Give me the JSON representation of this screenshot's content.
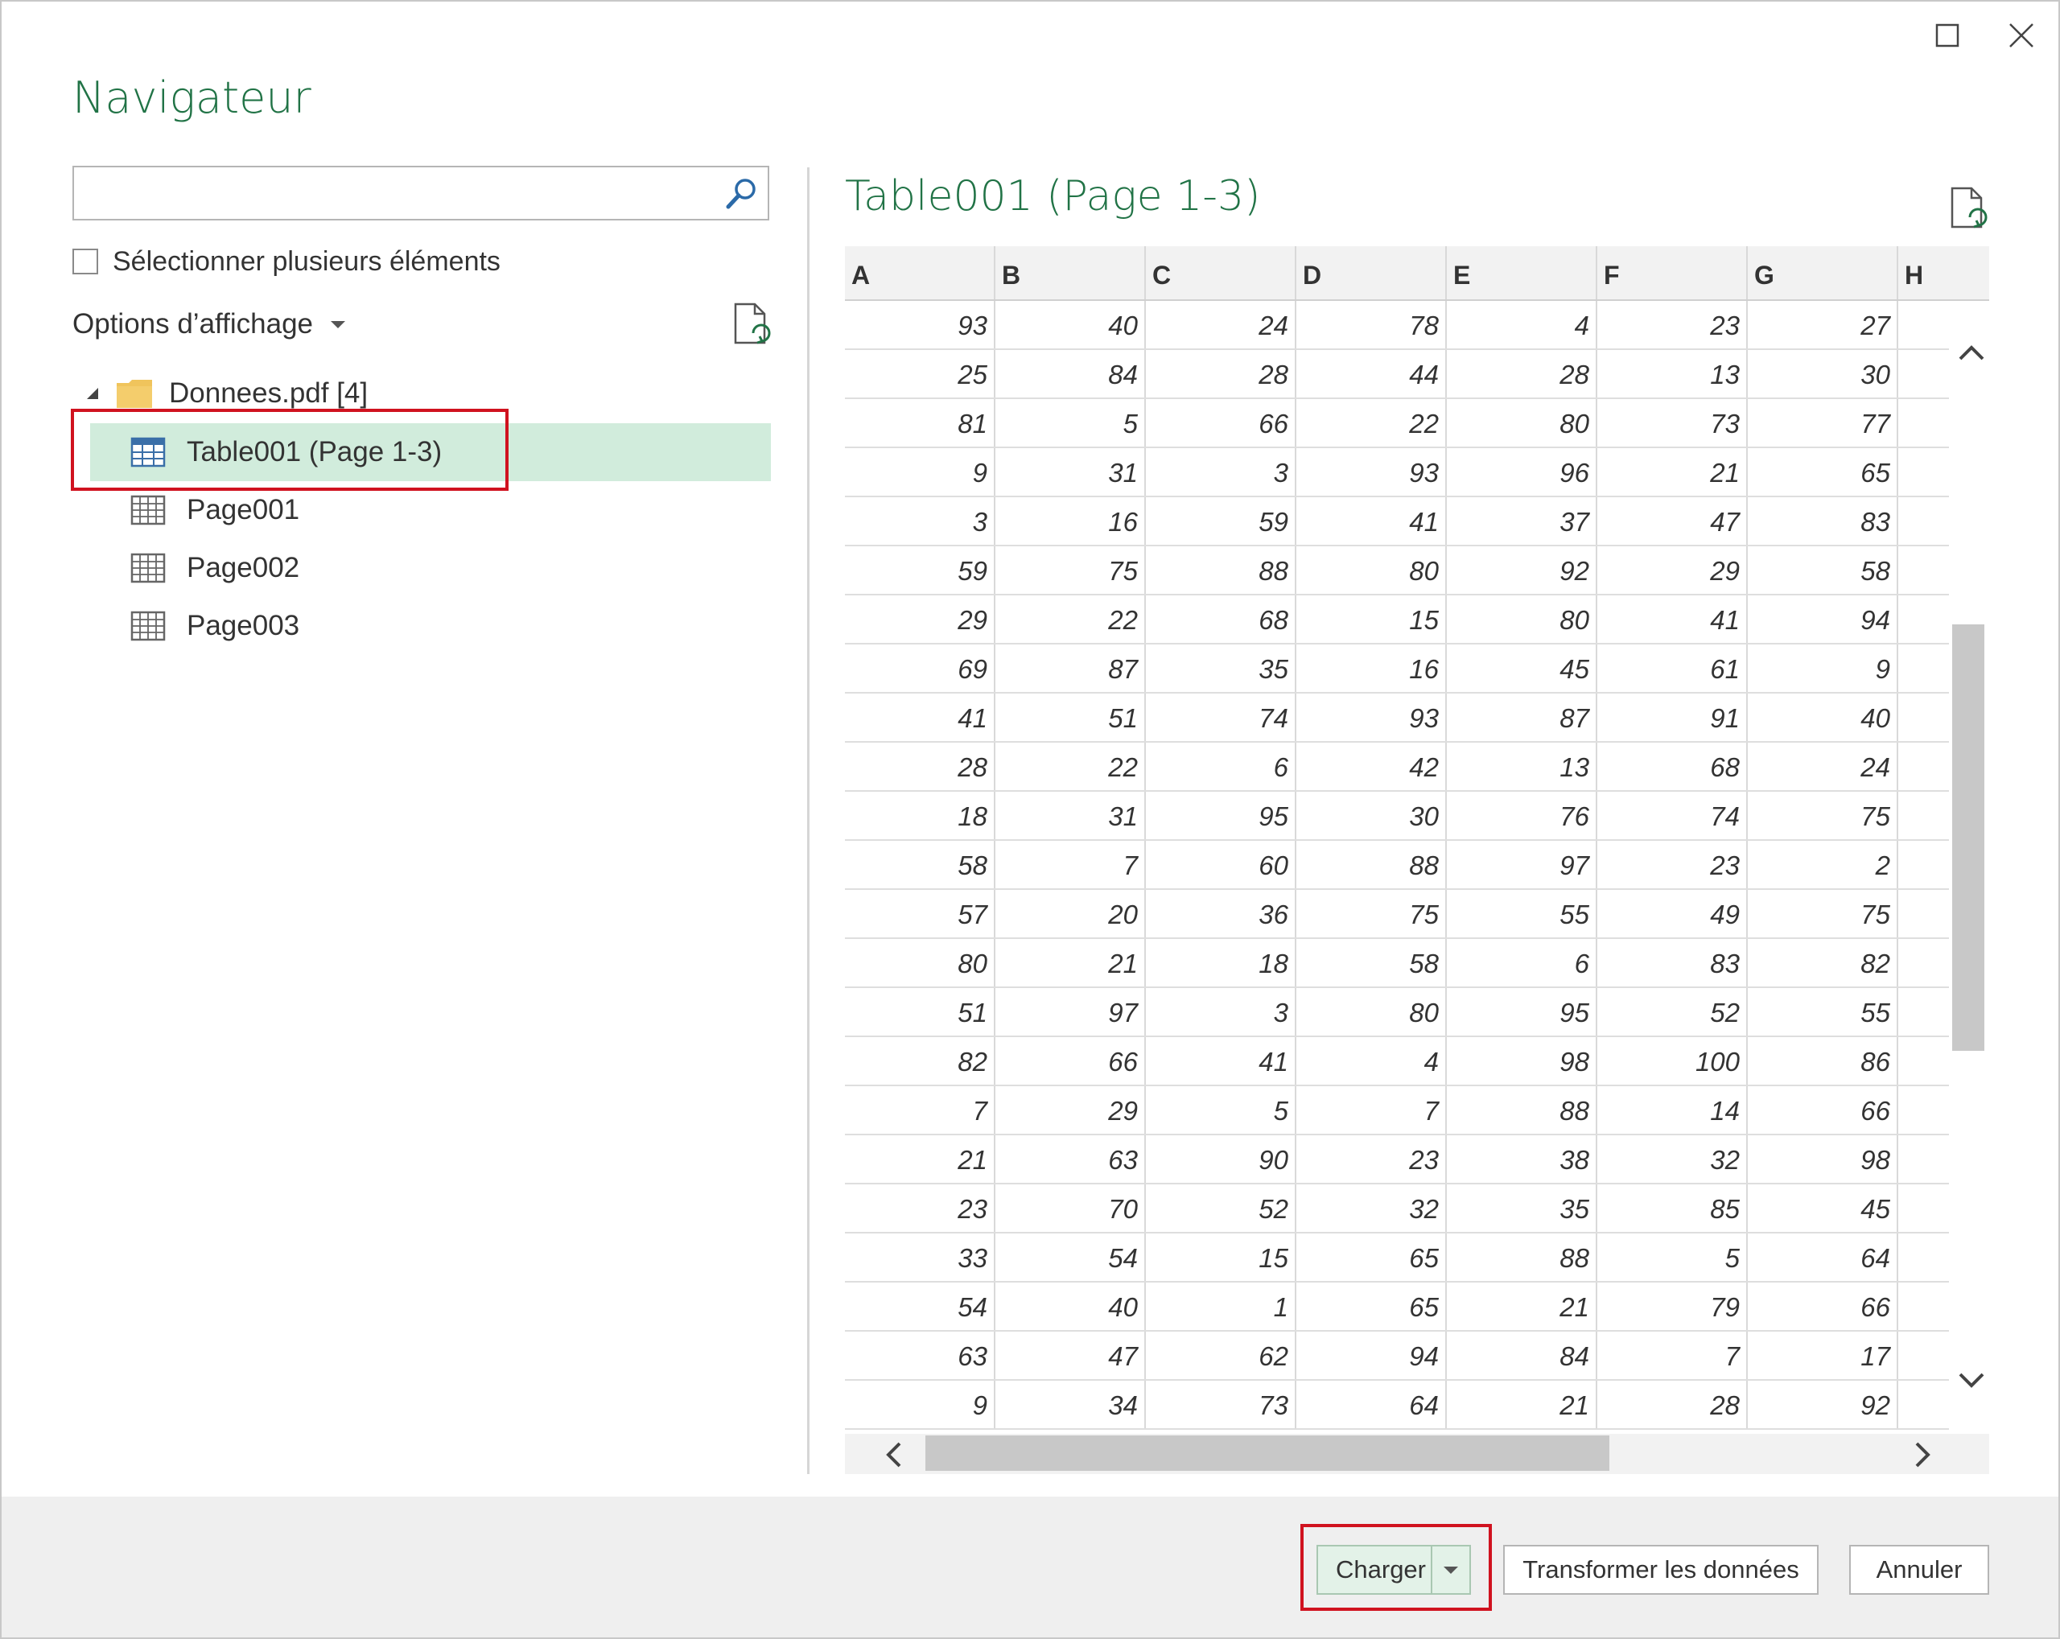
{
  "window": {
    "title": "Navigateur",
    "maximize_icon": "maximize-icon",
    "close_icon": "close-icon"
  },
  "left_pane": {
    "search": {
      "value": "",
      "placeholder": "",
      "icon": "search-icon"
    },
    "select_multiple_label": "Sélectionner plusieurs éléments",
    "display_options_label": "Options d’affichage",
    "refresh_icon": "refresh-document-icon",
    "tree": {
      "root_label": "Donnees.pdf [4]",
      "items": [
        {
          "label": "Table001 (Page 1-3)",
          "icon": "table-icon",
          "selected": true
        },
        {
          "label": "Page001",
          "icon": "page-grid-icon",
          "selected": false
        },
        {
          "label": "Page002",
          "icon": "page-grid-icon",
          "selected": false
        },
        {
          "label": "Page003",
          "icon": "page-grid-icon",
          "selected": false
        }
      ]
    }
  },
  "preview": {
    "title": "Table001 (Page 1-3)",
    "columns": [
      "A",
      "B",
      "C",
      "D",
      "E",
      "F",
      "G",
      "H"
    ],
    "rows": [
      [
        "93",
        "40",
        "24",
        "78",
        "4",
        "23",
        "27"
      ],
      [
        "25",
        "84",
        "28",
        "44",
        "28",
        "13",
        "30"
      ],
      [
        "81",
        "5",
        "66",
        "22",
        "80",
        "73",
        "77"
      ],
      [
        "9",
        "31",
        "3",
        "93",
        "96",
        "21",
        "65"
      ],
      [
        "3",
        "16",
        "59",
        "41",
        "37",
        "47",
        "83"
      ],
      [
        "59",
        "75",
        "88",
        "80",
        "92",
        "29",
        "58"
      ],
      [
        "29",
        "22",
        "68",
        "15",
        "80",
        "41",
        "94"
      ],
      [
        "69",
        "87",
        "35",
        "16",
        "45",
        "61",
        "9"
      ],
      [
        "41",
        "51",
        "74",
        "93",
        "87",
        "91",
        "40"
      ],
      [
        "28",
        "22",
        "6",
        "42",
        "13",
        "68",
        "24"
      ],
      [
        "18",
        "31",
        "95",
        "30",
        "76",
        "74",
        "75"
      ],
      [
        "58",
        "7",
        "60",
        "88",
        "97",
        "23",
        "2"
      ],
      [
        "57",
        "20",
        "36",
        "75",
        "55",
        "49",
        "75"
      ],
      [
        "80",
        "21",
        "18",
        "58",
        "6",
        "83",
        "82"
      ],
      [
        "51",
        "97",
        "3",
        "80",
        "95",
        "52",
        "55"
      ],
      [
        "82",
        "66",
        "41",
        "4",
        "98",
        "100",
        "86"
      ],
      [
        "7",
        "29",
        "5",
        "7",
        "88",
        "14",
        "66"
      ],
      [
        "21",
        "63",
        "90",
        "23",
        "38",
        "32",
        "98"
      ],
      [
        "23",
        "70",
        "52",
        "32",
        "35",
        "85",
        "45"
      ],
      [
        "33",
        "54",
        "15",
        "65",
        "88",
        "5",
        "64"
      ],
      [
        "54",
        "40",
        "1",
        "65",
        "21",
        "79",
        "66"
      ],
      [
        "63",
        "47",
        "62",
        "94",
        "84",
        "7",
        "17"
      ],
      [
        "9",
        "34",
        "73",
        "64",
        "21",
        "28",
        "92"
      ]
    ]
  },
  "footer": {
    "load_label": "Charger",
    "transform_label": "Transformer les données",
    "cancel_label": "Annuler"
  },
  "colors": {
    "accent_green": "#217346",
    "selection": "#d1ecdc",
    "highlight_red": "#d0121f"
  }
}
